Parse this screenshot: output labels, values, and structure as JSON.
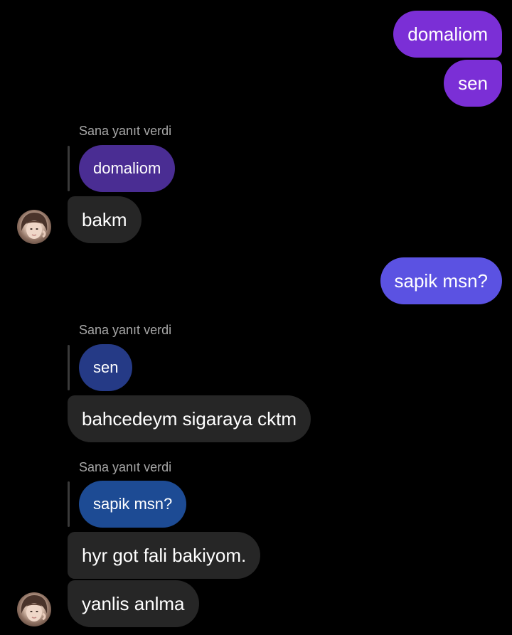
{
  "messages": {
    "out1": "domaliom",
    "out2": "sen",
    "reply1_label": "Sana yanıt verdi",
    "reply1_quote": "domaliom",
    "in1": "bakm",
    "out3": "sapik msn?",
    "reply2_label": "Sana yanıt verdi",
    "reply2_quote": "sen",
    "in2": "bahcedeym sigaraya cktm",
    "reply3_label": "Sana yanıt verdi",
    "reply3_quote": "sapik msn?",
    "in3": "hyr got fali bakiyom.",
    "in4": "yanlis anlma"
  },
  "colors": {
    "outgoing_purple": "#7b2fd6",
    "outgoing_violet": "#5b52e2",
    "incoming": "#262626",
    "quoted_purple": "#4a2d93",
    "quoted_blue": "#253a86",
    "quoted_blue_2": "#1d4b94"
  }
}
